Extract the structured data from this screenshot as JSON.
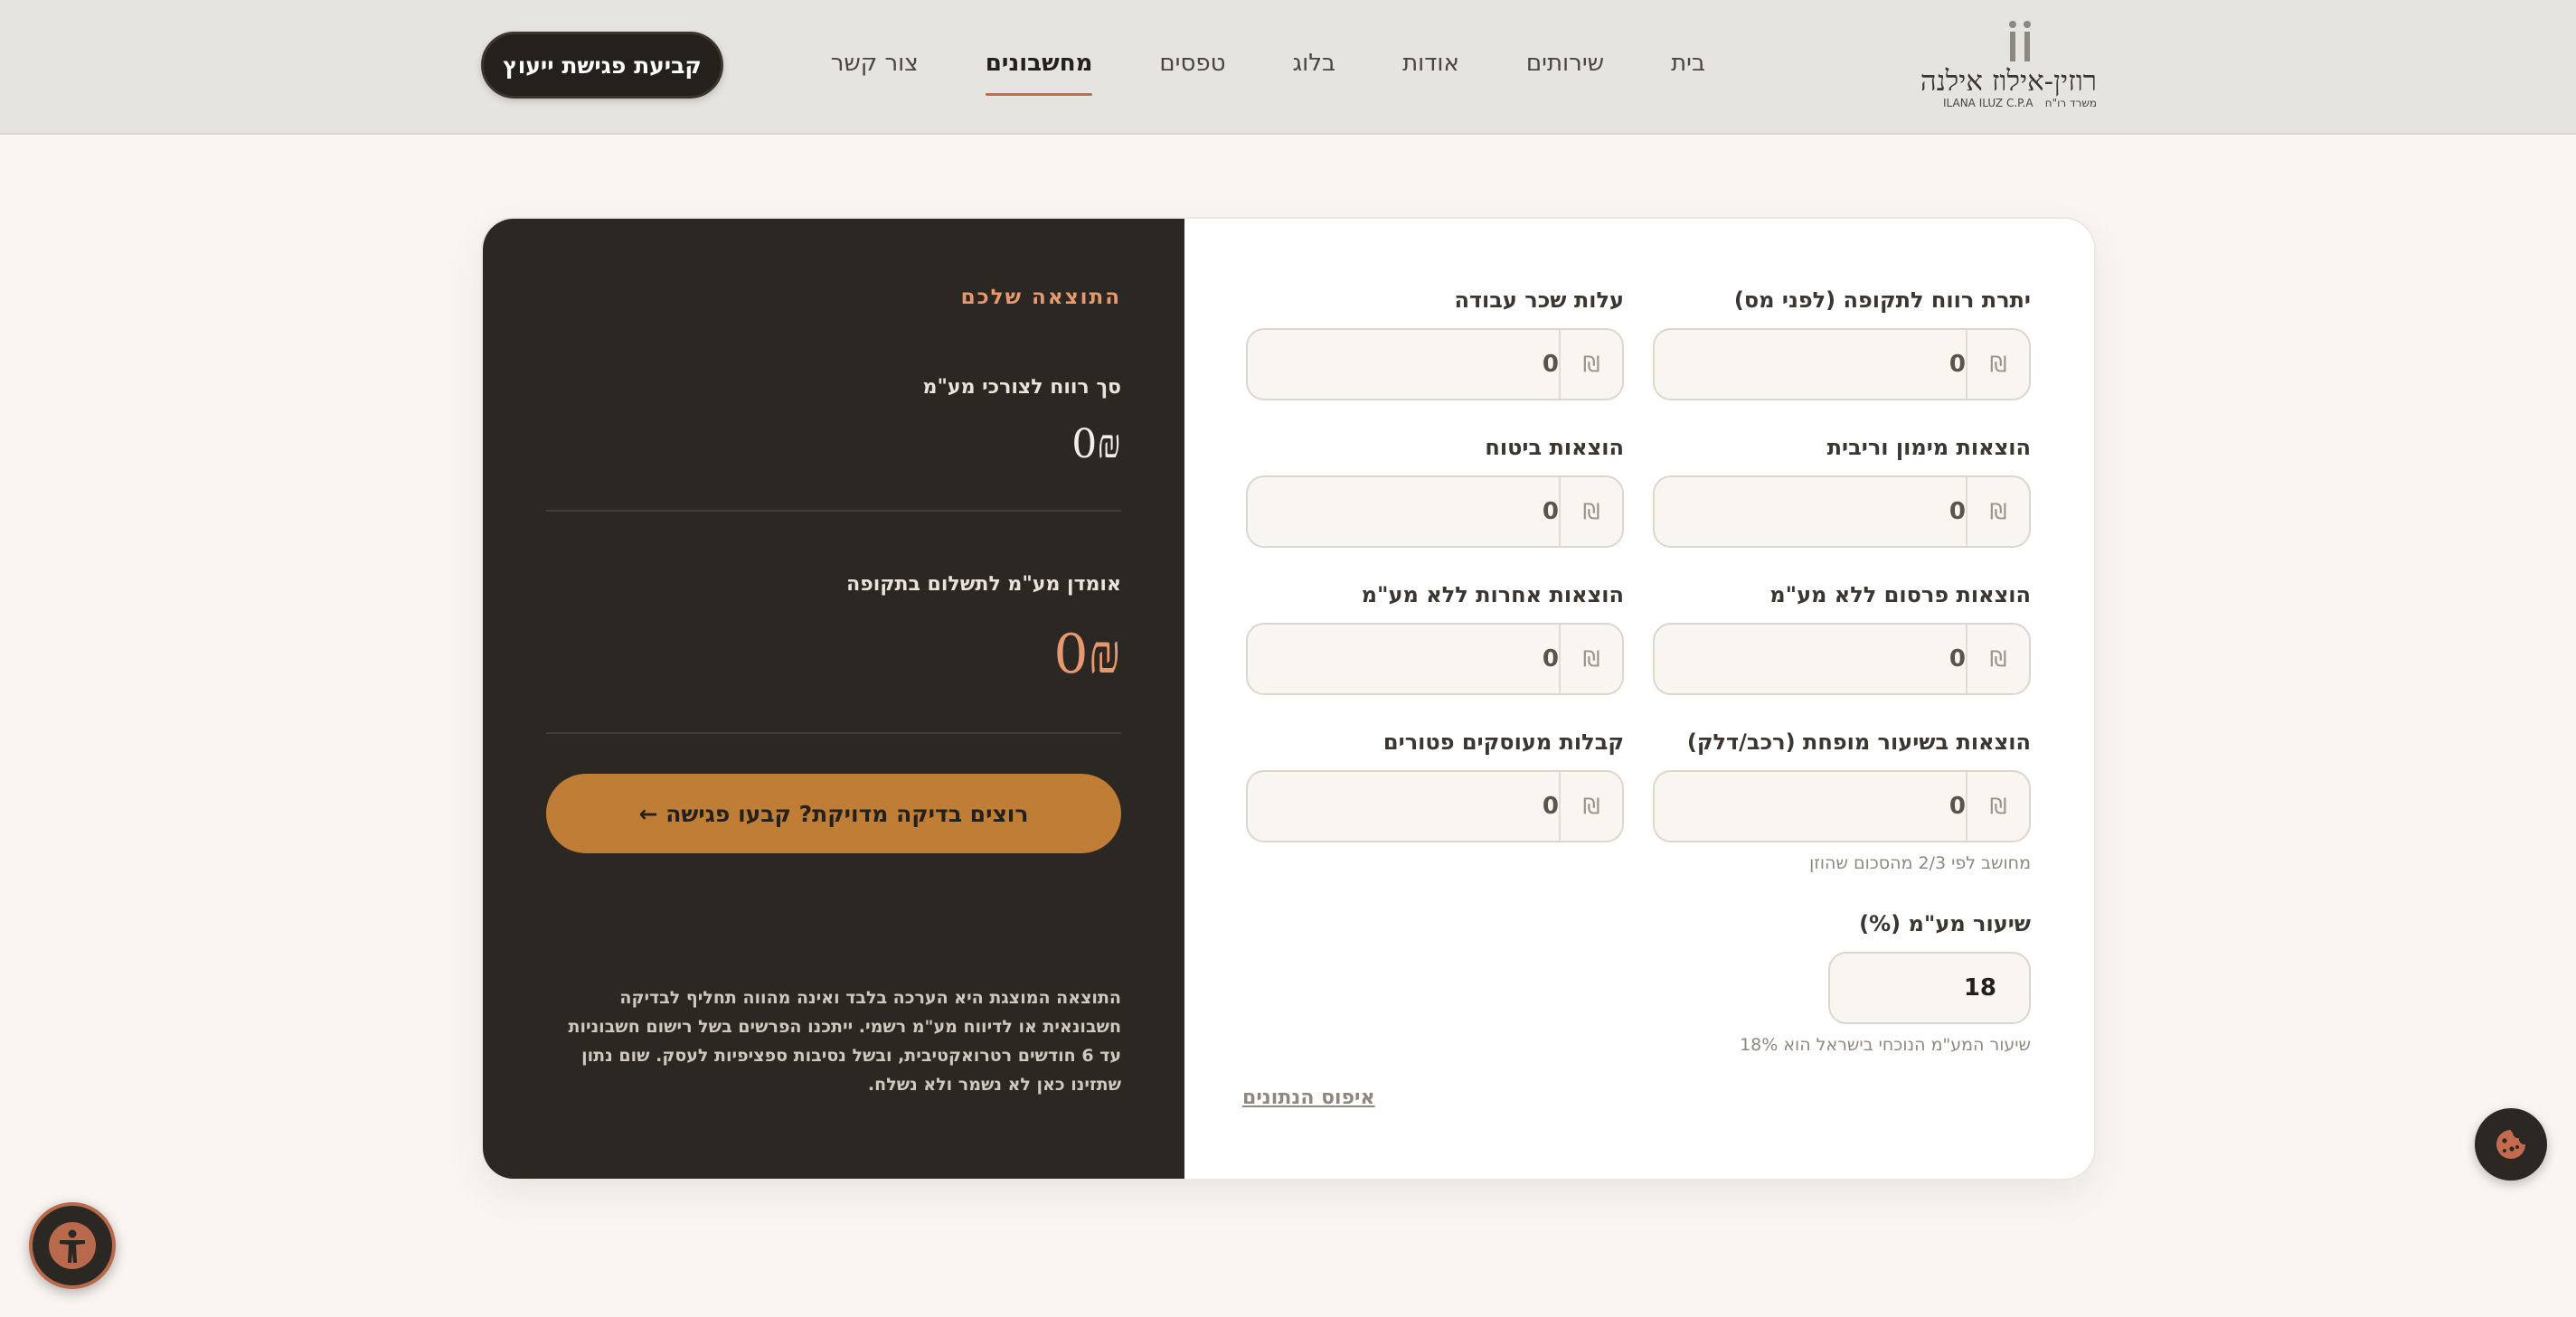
{
  "header": {
    "logo": {
      "name": "רוזין-אילוז אילנה",
      "sub_en": "ILANA ILUZ C.P.A",
      "sub_he": "משרד רו\"ח"
    },
    "nav": [
      {
        "label": "בית",
        "active": false
      },
      {
        "label": "שירותים",
        "active": false
      },
      {
        "label": "אודות",
        "active": false
      },
      {
        "label": "בלוג",
        "active": false
      },
      {
        "label": "טפסים",
        "active": false
      },
      {
        "label": "מחשבונים",
        "active": true
      },
      {
        "label": "צור קשר",
        "active": false
      }
    ],
    "cta_label": "קביעת פגישת ייעוץ"
  },
  "form": {
    "currency_symbol": "₪",
    "fields": [
      {
        "label": "יתרת רווח לתקופה (לפני מס)",
        "value": "0"
      },
      {
        "label": "עלות שכר עבודה",
        "value": "0"
      },
      {
        "label": "הוצאות מימון וריבית",
        "value": "0"
      },
      {
        "label": "הוצאות ביטוח",
        "value": "0"
      },
      {
        "label": "הוצאות פרסום ללא מע\"מ",
        "value": "0"
      },
      {
        "label": "הוצאות אחרות ללא מע\"מ",
        "value": "0"
      },
      {
        "label": "הוצאות בשיעור מופחת (רכב/דלק)",
        "value": "0",
        "hint": "מחושב לפי 2/3 מהסכום שהוזן"
      },
      {
        "label": "קבלות מעוסקים פטורים",
        "value": "0"
      }
    ],
    "vat_rate": {
      "label": "שיעור מע\"מ (%)",
      "value": "18",
      "hint": "שיעור המע\"מ הנוכחי בישראל הוא 18%"
    },
    "reset_label": "איפוס הנתונים"
  },
  "result": {
    "title": "התוצאה שלכם",
    "profit_label": "סך רווח לצורכי מע\"מ",
    "profit_value": "0₪",
    "vat_label": "אומדן מע\"מ לתשלום בתקופה",
    "vat_value": "0₪",
    "cta_label": "רוצים בדיקה מדויקת? קבעו פגישה ←",
    "disclaimer": "התוצאה המוצגת היא הערכה בלבד ואינה מהווה תחליף לבדיקה חשבונאית או לדיווח מע\"מ רשמי. ייתכנו הפרשים בשל רישום חשבוניות עד 6 חודשים רטרואקטיבית, ובשל נסיבות ספציפיות לעסק. שום נתון שתזינו כאן לא נשמר ולא נשלח."
  },
  "colors": {
    "accent": "#c46a4e",
    "cta": "#c07d35",
    "dark": "#2b2722",
    "result_title": "#e6986f"
  },
  "icons": {
    "cookie": "cookie-icon",
    "accessibility": "accessibility-icon"
  }
}
